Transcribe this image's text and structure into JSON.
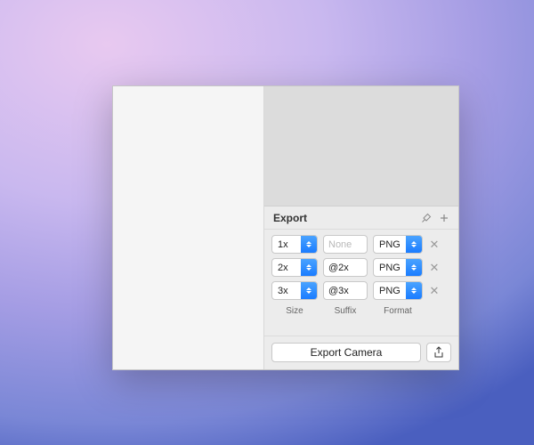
{
  "export": {
    "title": "Export",
    "columns": {
      "size": "Size",
      "suffix": "Suffix",
      "format": "Format"
    },
    "suffix_placeholder": "None",
    "rows": [
      {
        "size": "1x",
        "suffix": "",
        "format": "PNG"
      },
      {
        "size": "2x",
        "suffix": "@2x",
        "format": "PNG"
      },
      {
        "size": "3x",
        "suffix": "@3x",
        "format": "PNG"
      }
    ],
    "button": "Export Camera"
  }
}
